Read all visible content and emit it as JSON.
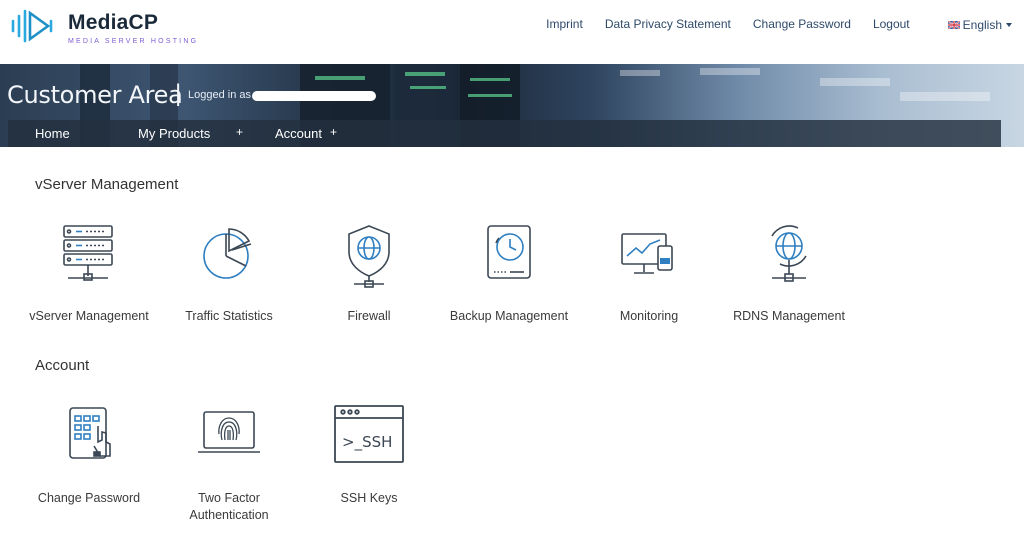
{
  "brand": {
    "name": "MediaCP",
    "tagline": "MEDIA SERVER HOSTING",
    "accent": "#29a9e0",
    "accent2": "#7c5cd6"
  },
  "topnav": {
    "imprint": "Imprint",
    "privacy": "Data Privacy Statement",
    "change_password": "Change Password",
    "logout": "Logout",
    "language": "English"
  },
  "banner": {
    "title": "Customer Area",
    "separator": "|",
    "logged_in": "Logged in as"
  },
  "mainnav": {
    "home": "Home",
    "products": "My Products",
    "products_plus": "+",
    "account": "Account",
    "account_plus": "+"
  },
  "vserver_section": {
    "title": "vServer Management",
    "tiles": [
      {
        "label": "vServer Management",
        "icon": "server-rack-icon"
      },
      {
        "label": "Traffic Statistics",
        "icon": "pie-chart-icon"
      },
      {
        "label": "Firewall",
        "icon": "shield-globe-icon"
      },
      {
        "label": "Backup Management",
        "icon": "backup-clock-icon"
      },
      {
        "label": "Monitoring",
        "icon": "monitor-chart-icon"
      },
      {
        "label": "RDNS Management",
        "icon": "globe-network-icon"
      }
    ]
  },
  "account_section": {
    "title": "Account",
    "tiles": [
      {
        "label": "Change Password",
        "icon": "keypad-hand-icon"
      },
      {
        "label_line1": "Two Factor",
        "label_line2": "Authentication",
        "icon": "fingerprint-laptop-icon"
      },
      {
        "label": "SSH Keys",
        "icon": "ssh-terminal-icon",
        "icon_text": ">_SSH"
      }
    ]
  }
}
